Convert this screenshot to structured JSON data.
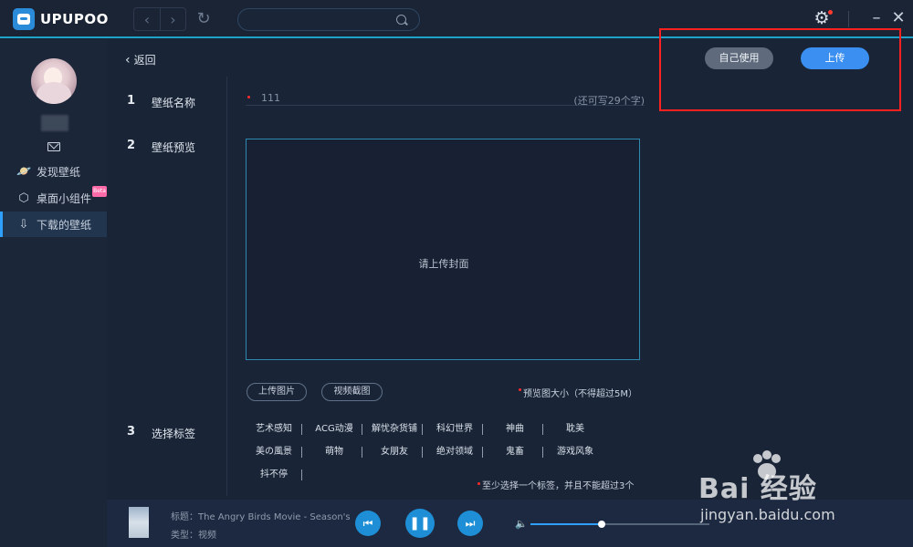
{
  "app": {
    "logo_text": "UPUPOO"
  },
  "search": {
    "placeholder": ""
  },
  "sidebar": {
    "items": [
      {
        "label": "发现壁纸",
        "icon": "planet-icon"
      },
      {
        "label": "桌面小组件",
        "icon": "widget-icon",
        "badge": "Beta"
      },
      {
        "label": "下载的壁纸",
        "icon": "download-icon",
        "active": true
      }
    ]
  },
  "main": {
    "back_label": "返回",
    "actions": {
      "self_use": "自己使用",
      "upload": "上传"
    },
    "steps": [
      {
        "num": "1",
        "label": "壁纸名称"
      },
      {
        "num": "2",
        "label": "壁纸预览"
      },
      {
        "num": "3",
        "label": "选择标签"
      }
    ],
    "name_field": {
      "value": "111",
      "hint": "(还可写29个字)"
    },
    "preview": {
      "placeholder": "请上传封面"
    },
    "preview_buttons": {
      "upload_image": "上传图片",
      "video_capture": "视频截图"
    },
    "size_note": "预览图大小（不得超过5M）",
    "tags": [
      "艺术感知",
      "ACG动漫",
      "解忧杂货铺",
      "科幻世界",
      "神曲",
      "耽美",
      "美の風景",
      "萌物",
      "女朋友",
      "绝对领域",
      "鬼畜",
      "游戏风象",
      "抖不停"
    ],
    "tag_note": "至少选择一个标签，并且不能超过3个"
  },
  "player": {
    "title": "标题：The Angry Birds Movie - Season's",
    "type": "类型：视频",
    "volume": 0.4
  },
  "watermark": {
    "brand": "Bai 经验",
    "url": "jingyan.baidu.com"
  },
  "colors": {
    "accent": "#2fa0ff",
    "upload_button": "#3a8ff0",
    "highlight": "#ff2020"
  }
}
